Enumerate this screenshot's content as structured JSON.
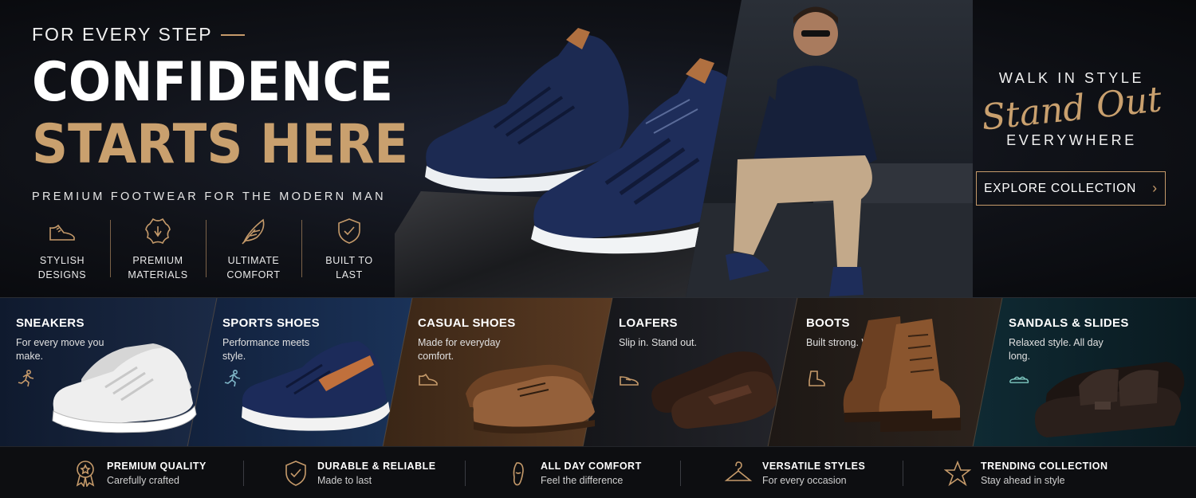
{
  "hero": {
    "eyebrow": "FOR EVERY STEP",
    "headline_line1": "CONFIDENCE",
    "headline_line2": "STARTS HERE",
    "subtitle": "PREMIUM FOOTWEAR FOR THE MODERN MAN",
    "features": [
      {
        "icon": "shoe-icon",
        "label": "STYLISH\nDESIGNS"
      },
      {
        "icon": "leather-icon",
        "label": "PREMIUM\nMATERIALS"
      },
      {
        "icon": "feather-icon",
        "label": "ULTIMATE\nCOMFORT"
      },
      {
        "icon": "shield-check-icon",
        "label": "BUILT TO\nLAST"
      }
    ],
    "tagline_top": "WALK IN STYLE",
    "tagline_script": "Stand Out",
    "tagline_bottom": "EVERYWHERE",
    "cta_label": "EXPLORE COLLECTION"
  },
  "categories": [
    {
      "title": "SNEAKERS",
      "desc": "For every move you make.",
      "icon": "running-icon",
      "icon_color": "#c59a6a",
      "shoe_color": "#e8e8e8"
    },
    {
      "title": "SPORTS SHOES",
      "desc": "Performance meets style.",
      "icon": "running-icon",
      "icon_color": "#7fb6c8",
      "shoe_color": "#1e2d5a"
    },
    {
      "title": "CASUAL SHOES",
      "desc": "Made for everyday comfort.",
      "icon": "shoe-icon",
      "icon_color": "#c59a6a",
      "shoe_color": "#8a5530"
    },
    {
      "title": "LOAFERS",
      "desc": "Slip in. Stand out.",
      "icon": "loafer-icon",
      "icon_color": "#c59a6a",
      "shoe_color": "#3b2419"
    },
    {
      "title": "BOOTS",
      "desc": "Built strong. Walk tall.",
      "icon": "boot-icon",
      "icon_color": "#c59a6a",
      "shoe_color": "#7a4a26"
    },
    {
      "title": "SANDALS & SLIDES",
      "desc": "Relaxed style. All day long.",
      "icon": "sandal-icon",
      "icon_color": "#7fc8c0",
      "shoe_color": "#2a1f1b"
    }
  ],
  "benefits": [
    {
      "icon": "award-icon",
      "title": "PREMIUM QUALITY",
      "sub": "Carefully crafted"
    },
    {
      "icon": "shield-check-icon",
      "title": "DURABLE & RELIABLE",
      "sub": "Made to last"
    },
    {
      "icon": "footprint-icon",
      "title": "ALL DAY COMFORT",
      "sub": "Feel the difference"
    },
    {
      "icon": "hanger-icon",
      "title": "VERSATILE STYLES",
      "sub": "For every occasion"
    },
    {
      "icon": "star-icon",
      "title": "TRENDING COLLECTION",
      "sub": "Stay ahead in style"
    }
  ],
  "colors": {
    "accent": "#c59a6a",
    "navy": "#1c2a52",
    "background": "#0b0c0f"
  }
}
